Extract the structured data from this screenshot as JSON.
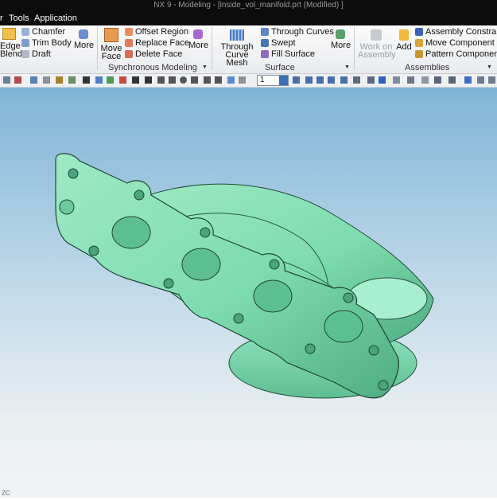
{
  "window": {
    "title": "NX 9 - Modeling - [inside_vol_manifold.prt (Modified) ]"
  },
  "menu": {
    "items": [
      "r",
      "Tools",
      "Application"
    ]
  },
  "ribbon": {
    "edge_blend": "Edge Blend",
    "chamfer": "Chamfer",
    "trim_body": "Trim Body",
    "draft": "Draft",
    "more_feature": "More",
    "move_face": "Move Face",
    "offset_region": "Offset Region",
    "replace_face": "Replace Face",
    "delete_face": "Delete Face",
    "more_sync": "More",
    "group_sync": "Synchronous Modeling",
    "through_curve_mesh": "Through Curve Mesh",
    "through_curves": "Through Curves",
    "swept": "Swept",
    "fill_surface": "Fill Surface",
    "more_surface": "More",
    "group_surface": "Surface",
    "work_on_assembly": "Work on Assembly",
    "add": "Add",
    "assembly_constraint": "Assembly Constraint",
    "move_component": "Move Component",
    "pattern_component": "Pattern Component",
    "group_assemblies": "Assemblies"
  },
  "toolbar": {
    "layer_value": "1"
  },
  "viewport": {
    "model": "exhaust-manifold",
    "model_color": "#7ddcae",
    "triad_label": "ZC"
  },
  "colors": {
    "titlebar": "#0c0c0c",
    "ribbon_bg": "#f3f4f6",
    "viewport_top": "#7fb4d6",
    "viewport_bottom": "#f1f3f4"
  }
}
